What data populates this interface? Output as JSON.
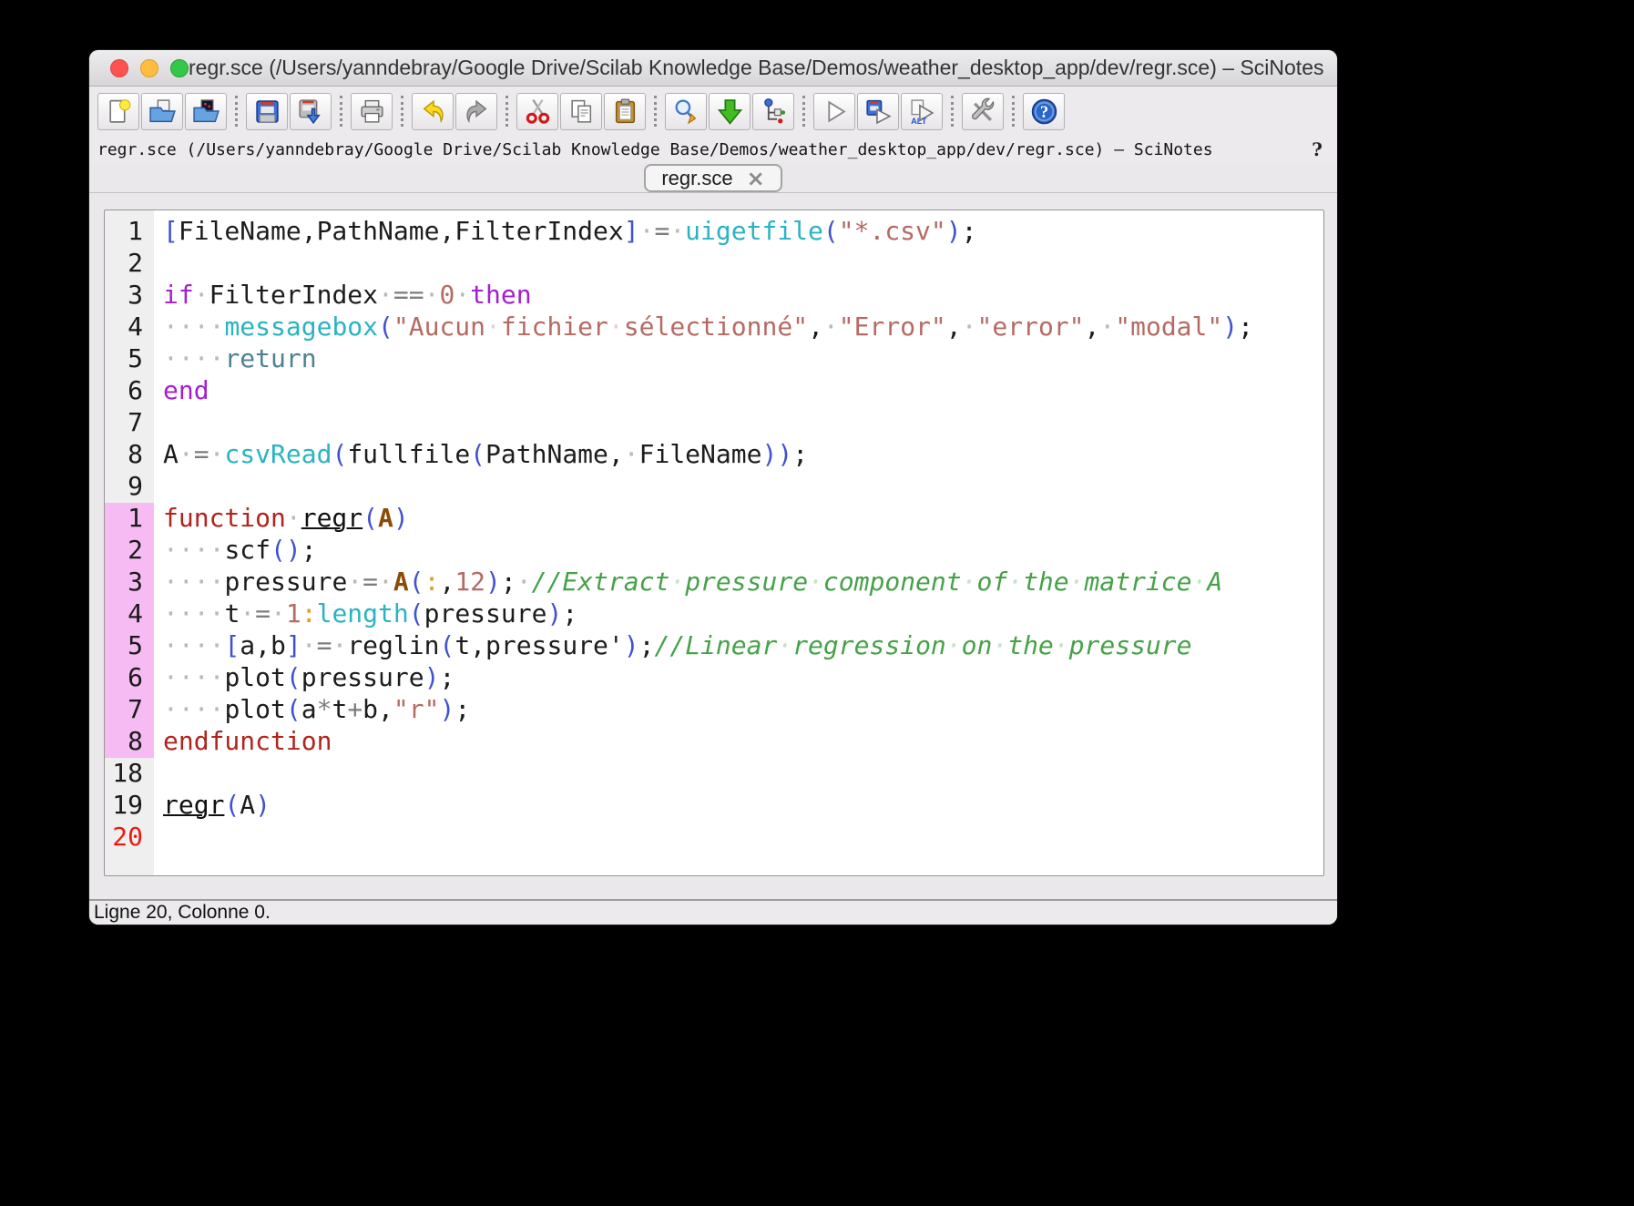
{
  "window": {
    "title": "regr.sce (/Users/yanndebray/Google Drive/Scilab Knowledge Base/Demos/weather_desktop_app/dev/regr.sce) – SciNotes"
  },
  "toolbar": {
    "groups": [
      {
        "buttons": [
          {
            "name": "new-file",
            "icon": "new-file"
          },
          {
            "name": "open-file",
            "icon": "open-file"
          },
          {
            "name": "open-in-scilab",
            "icon": "open-dark"
          }
        ]
      },
      {
        "buttons": [
          {
            "name": "save",
            "icon": "save"
          },
          {
            "name": "save-as",
            "icon": "save-as"
          }
        ]
      },
      {
        "buttons": [
          {
            "name": "print",
            "icon": "print"
          }
        ]
      },
      {
        "buttons": [
          {
            "name": "undo",
            "icon": "undo"
          },
          {
            "name": "redo",
            "icon": "redo"
          }
        ]
      },
      {
        "buttons": [
          {
            "name": "cut",
            "icon": "cut"
          },
          {
            "name": "copy",
            "icon": "copy"
          },
          {
            "name": "paste",
            "icon": "paste"
          }
        ]
      },
      {
        "buttons": [
          {
            "name": "find-replace",
            "icon": "find"
          },
          {
            "name": "load-into-scilab",
            "icon": "load"
          },
          {
            "name": "code-navigator",
            "icon": "navigator"
          }
        ]
      },
      {
        "buttons": [
          {
            "name": "execute",
            "icon": "play"
          },
          {
            "name": "save-and-execute",
            "icon": "save-play"
          },
          {
            "name": "execute-no-echo",
            "icon": "play-alt"
          }
        ]
      },
      {
        "buttons": [
          {
            "name": "preferences",
            "icon": "tools"
          }
        ]
      },
      {
        "buttons": [
          {
            "name": "help",
            "icon": "help"
          }
        ]
      }
    ]
  },
  "path_bar": {
    "text": "regr.sce (/Users/yanndebray/Google Drive/Scilab Knowledge Base/Demos/weather_desktop_app/dev/regr.sce) – SciNotes",
    "help": "?"
  },
  "tab": {
    "label": "regr.sce",
    "close_glyph": "×"
  },
  "editor": {
    "lines": [
      {
        "n": "1",
        "seg": [
          {
            "t": "[",
            "c": "par"
          },
          {
            "t": "FileName,PathName,FilterIndex",
            "c": "id"
          },
          {
            "t": "]",
            "c": "par"
          },
          {
            "t": " ",
            "c": "id"
          },
          {
            "t": "=",
            "c": "op"
          },
          {
            "t": " ",
            "c": "id"
          },
          {
            "t": "uigetfile",
            "c": "fn"
          },
          {
            "t": "(",
            "c": "par"
          },
          {
            "t": "\"*.csv\"",
            "c": "str"
          },
          {
            "t": ")",
            "c": "par"
          },
          {
            "t": ";",
            "c": "id"
          }
        ]
      },
      {
        "n": "2",
        "seg": []
      },
      {
        "n": "3",
        "seg": [
          {
            "t": "if",
            "c": "kw"
          },
          {
            "t": " ",
            "c": "id"
          },
          {
            "t": "FilterIndex",
            "c": "id"
          },
          {
            "t": " ",
            "c": "id"
          },
          {
            "t": "==",
            "c": "op"
          },
          {
            "t": " ",
            "c": "id"
          },
          {
            "t": "0",
            "c": "num"
          },
          {
            "t": " ",
            "c": "id"
          },
          {
            "t": "then",
            "c": "kw"
          }
        ]
      },
      {
        "n": "4",
        "seg": [
          {
            "t": "    ",
            "c": "id"
          },
          {
            "t": "messagebox",
            "c": "fn"
          },
          {
            "t": "(",
            "c": "par"
          },
          {
            "t": "\"Aucun fichier sélectionné\"",
            "c": "str"
          },
          {
            "t": ",",
            "c": "id"
          },
          {
            "t": " ",
            "c": "id"
          },
          {
            "t": "\"Error\"",
            "c": "str"
          },
          {
            "t": ",",
            "c": "id"
          },
          {
            "t": " ",
            "c": "id"
          },
          {
            "t": "\"error\"",
            "c": "str"
          },
          {
            "t": ",",
            "c": "id"
          },
          {
            "t": " ",
            "c": "id"
          },
          {
            "t": "\"modal\"",
            "c": "str"
          },
          {
            "t": ")",
            "c": "par"
          },
          {
            "t": ";",
            "c": "id"
          }
        ]
      },
      {
        "n": "5",
        "seg": [
          {
            "t": "    ",
            "c": "id"
          },
          {
            "t": "return",
            "c": "ctrl"
          }
        ]
      },
      {
        "n": "6",
        "seg": [
          {
            "t": "end",
            "c": "kw"
          }
        ]
      },
      {
        "n": "7",
        "seg": []
      },
      {
        "n": "8",
        "seg": [
          {
            "t": "A",
            "c": "id"
          },
          {
            "t": " ",
            "c": "id"
          },
          {
            "t": "=",
            "c": "op"
          },
          {
            "t": " ",
            "c": "id"
          },
          {
            "t": "csvRead",
            "c": "fn"
          },
          {
            "t": "(",
            "c": "par"
          },
          {
            "t": "fullfile",
            "c": "id"
          },
          {
            "t": "(",
            "c": "par"
          },
          {
            "t": "PathName,",
            "c": "id"
          },
          {
            "t": " ",
            "c": "id"
          },
          {
            "t": "FileName",
            "c": "id"
          },
          {
            "t": "))",
            "c": "par"
          },
          {
            "t": ";",
            "c": "id"
          }
        ]
      },
      {
        "n": "9",
        "seg": []
      },
      {
        "n": "1",
        "hl": true,
        "seg": [
          {
            "t": "function",
            "c": "def"
          },
          {
            "t": " ",
            "c": "id"
          },
          {
            "t": "regr",
            "c": "uname"
          },
          {
            "t": "(",
            "c": "par"
          },
          {
            "t": "A",
            "c": "arg"
          },
          {
            "t": ")",
            "c": "par"
          }
        ]
      },
      {
        "n": "2",
        "hl": true,
        "seg": [
          {
            "t": "    ",
            "c": "id"
          },
          {
            "t": "scf",
            "c": "id"
          },
          {
            "t": "()",
            "c": "par"
          },
          {
            "t": ";",
            "c": "id"
          }
        ]
      },
      {
        "n": "3",
        "hl": true,
        "seg": [
          {
            "t": "    ",
            "c": "id"
          },
          {
            "t": "pressure",
            "c": "id"
          },
          {
            "t": " ",
            "c": "id"
          },
          {
            "t": "=",
            "c": "op"
          },
          {
            "t": " ",
            "c": "id"
          },
          {
            "t": "A",
            "c": "arg"
          },
          {
            "t": "(",
            "c": "par"
          },
          {
            "t": ":",
            "c": "colon"
          },
          {
            "t": ",",
            "c": "id"
          },
          {
            "t": "12",
            "c": "num"
          },
          {
            "t": ")",
            "c": "par"
          },
          {
            "t": ";",
            "c": "id"
          },
          {
            "t": " ",
            "c": "id"
          },
          {
            "t": "//Extract pressure component of the matrice A",
            "c": "cmt"
          }
        ]
      },
      {
        "n": "4",
        "hl": true,
        "seg": [
          {
            "t": "    ",
            "c": "id"
          },
          {
            "t": "t",
            "c": "id"
          },
          {
            "t": " ",
            "c": "id"
          },
          {
            "t": "=",
            "c": "op"
          },
          {
            "t": " ",
            "c": "id"
          },
          {
            "t": "1",
            "c": "num"
          },
          {
            "t": ":",
            "c": "colon"
          },
          {
            "t": "length",
            "c": "fn"
          },
          {
            "t": "(",
            "c": "par"
          },
          {
            "t": "pressure",
            "c": "id"
          },
          {
            "t": ")",
            "c": "par"
          },
          {
            "t": ";",
            "c": "id"
          }
        ]
      },
      {
        "n": "5",
        "hl": true,
        "seg": [
          {
            "t": "    ",
            "c": "id"
          },
          {
            "t": "[",
            "c": "par"
          },
          {
            "t": "a,b",
            "c": "id"
          },
          {
            "t": "]",
            "c": "par"
          },
          {
            "t": " ",
            "c": "id"
          },
          {
            "t": "=",
            "c": "op"
          },
          {
            "t": " ",
            "c": "id"
          },
          {
            "t": "reglin",
            "c": "id"
          },
          {
            "t": "(",
            "c": "par"
          },
          {
            "t": "t,pressure'",
            "c": "id"
          },
          {
            "t": ")",
            "c": "par"
          },
          {
            "t": ";",
            "c": "id"
          },
          {
            "t": "//Linear regression on the pressure",
            "c": "cmt"
          }
        ]
      },
      {
        "n": "6",
        "hl": true,
        "seg": [
          {
            "t": "    ",
            "c": "id"
          },
          {
            "t": "plot",
            "c": "id"
          },
          {
            "t": "(",
            "c": "par"
          },
          {
            "t": "pressure",
            "c": "id"
          },
          {
            "t": ")",
            "c": "par"
          },
          {
            "t": ";",
            "c": "id"
          }
        ]
      },
      {
        "n": "7",
        "hl": true,
        "seg": [
          {
            "t": "    ",
            "c": "id"
          },
          {
            "t": "plot",
            "c": "id"
          },
          {
            "t": "(",
            "c": "par"
          },
          {
            "t": "a",
            "c": "id"
          },
          {
            "t": "*",
            "c": "op"
          },
          {
            "t": "t",
            "c": "id"
          },
          {
            "t": "+",
            "c": "op"
          },
          {
            "t": "b,",
            "c": "id"
          },
          {
            "t": "\"r\"",
            "c": "str"
          },
          {
            "t": ")",
            "c": "par"
          },
          {
            "t": ";",
            "c": "id"
          }
        ]
      },
      {
        "n": "8",
        "hl": true,
        "seg": [
          {
            "t": "endfunction",
            "c": "def"
          }
        ]
      },
      {
        "n": "18",
        "seg": []
      },
      {
        "n": "19",
        "seg": [
          {
            "t": "regr",
            "c": "uname"
          },
          {
            "t": "(",
            "c": "par"
          },
          {
            "t": "A",
            "c": "id"
          },
          {
            "t": ")",
            "c": "par"
          }
        ]
      },
      {
        "n": "20",
        "cur": true,
        "seg": []
      }
    ]
  },
  "status_bar": {
    "text": "Ligne 20, Colonne 0."
  }
}
